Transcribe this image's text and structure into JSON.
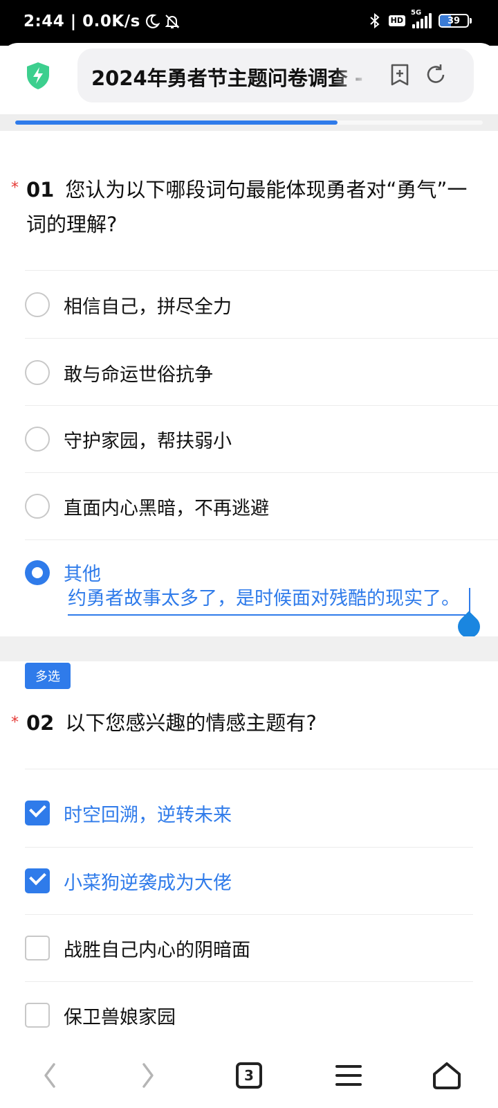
{
  "status_bar": {
    "time_network": "2:44 | 0.0K/s",
    "hd_label": "HD",
    "signal_label": "5G",
    "battery_level": "39",
    "battery_fraction": 0.39
  },
  "browser": {
    "page_title": "2024年勇者节主题问卷调查 - ",
    "icons": {
      "security": "shield-lightning-icon",
      "add_bookmark": "bookmark-plus-icon",
      "reload": "refresh-icon"
    },
    "load_progress": 0.69
  },
  "question1": {
    "required_mark": "*",
    "number": "01",
    "text": "您认为以下哪段词句最能体现勇者对“勇气”一词的理解?",
    "options": [
      {
        "label": "相信自己，拼尽全力",
        "selected": false
      },
      {
        "label": "敢与命运世俗抗争",
        "selected": false
      },
      {
        "label": "守护家园，帮扶弱小",
        "selected": false
      },
      {
        "label": "直面内心黑暗，不再逃避",
        "selected": false
      },
      {
        "label": "其他",
        "selected": true
      }
    ],
    "other_input_value": "约勇者故事太多了，是时候面对残酷的现实了。"
  },
  "question2": {
    "type_badge": "多选",
    "required_mark": "*",
    "number": "02",
    "text": "以下您感兴趣的情感主题有?",
    "options": [
      {
        "label": "时空回溯，逆转未来",
        "checked": true
      },
      {
        "label": "小菜狗逆袭成为大佬",
        "checked": true
      },
      {
        "label": "战胜自己内心的阴暗面",
        "checked": false
      },
      {
        "label": "保卫兽娘家园",
        "checked": false
      }
    ]
  },
  "nav_bar": {
    "tab_count": "3",
    "icons": {
      "back": "chevron-left-icon",
      "forward": "chevron-right-icon",
      "menu": "menu-icon",
      "home": "home-icon"
    }
  }
}
